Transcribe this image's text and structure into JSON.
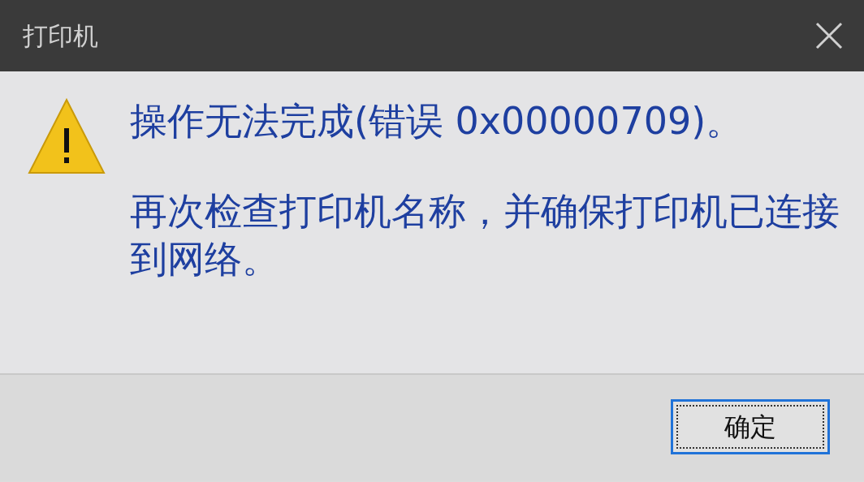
{
  "window": {
    "title": "打印机"
  },
  "message": {
    "instruction": "操作无法完成(错误 0x00000709)。",
    "detail": "再次检查打印机名称，并确保打印机已连接到网络。"
  },
  "buttons": [
    {
      "label": "确定",
      "focused": true
    }
  ]
}
